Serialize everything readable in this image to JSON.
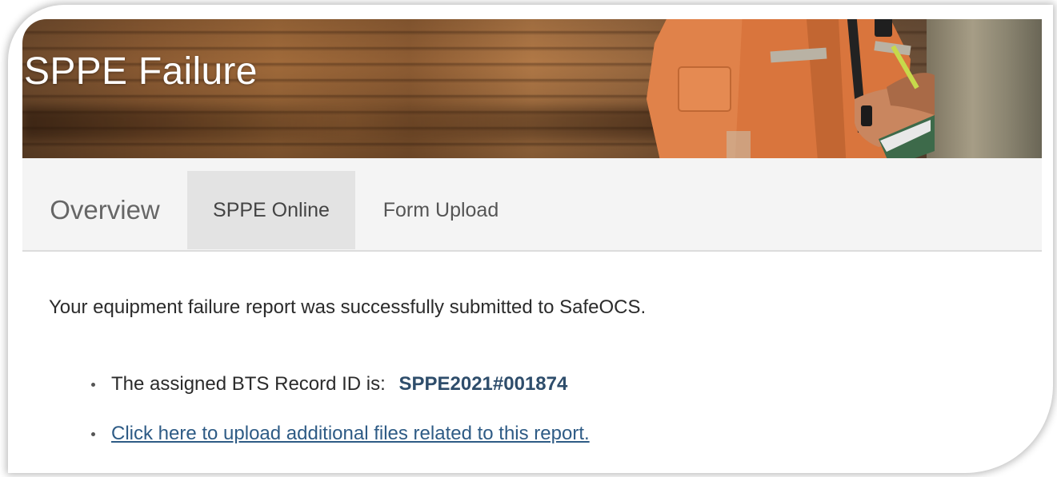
{
  "page_title": "SPPE Failure",
  "tabs": [
    {
      "label": "Overview"
    },
    {
      "label": "SPPE Online"
    },
    {
      "label": "Form Upload"
    }
  ],
  "content": {
    "message": "Your equipment failure report was successfully submitted to SafeOCS.",
    "record_label": "The assigned BTS Record ID is:",
    "record_id": "SPPE2021#001874",
    "upload_link": "Click here to upload additional files related to this report."
  },
  "colors": {
    "link": "#2e5b85",
    "record_id": "#2e4d6b",
    "active_tab_bg": "#e3e3e3",
    "tab_bar_bg": "#f4f4f4"
  }
}
